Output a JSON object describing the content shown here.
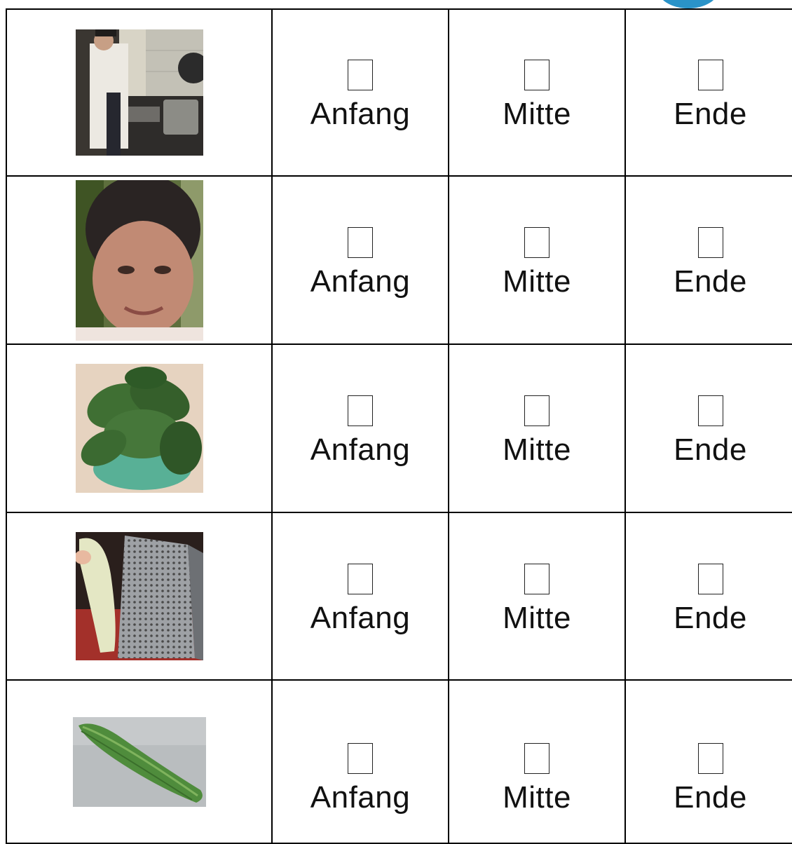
{
  "options": {
    "beginning": "Anfang",
    "middle": "Mitte",
    "end": "Ende"
  },
  "rows": [
    {
      "image": "chef cooking at a stove"
    },
    {
      "image": "smiling woman portrait"
    },
    {
      "image": "bunch of spinach leaves"
    },
    {
      "image": "cucumber on a metal grater"
    },
    {
      "image": "cucumber lying on a surface"
    }
  ]
}
